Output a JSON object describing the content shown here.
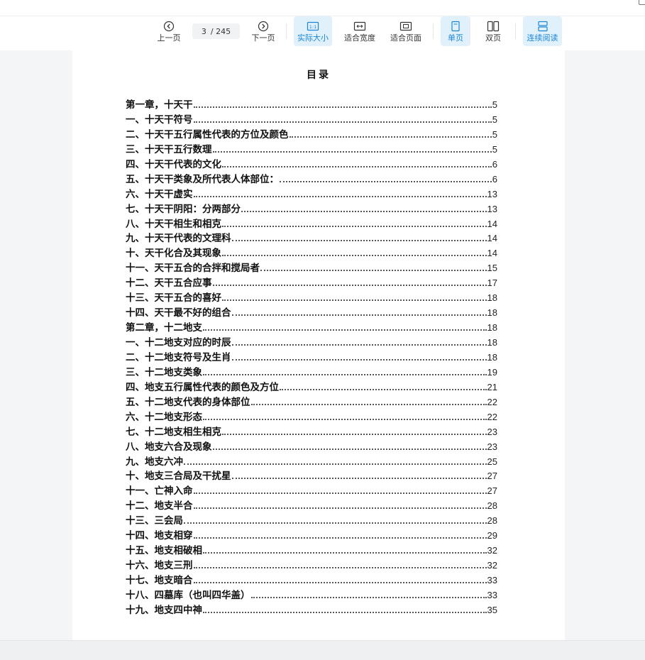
{
  "toolbar": {
    "page_current": "3",
    "page_total": "/ 245",
    "prev_label": "上一页",
    "next_label": "下一页",
    "actual_size_label": "实际大小",
    "fit_width_label": "适合宽度",
    "fit_page_label": "适合页面",
    "single_page_label": "单页",
    "double_page_label": "双页",
    "continuous_label": "连续阅读",
    "active_color": "#1b86d6",
    "active_bg": "#e1f1fb"
  },
  "document": {
    "title": "目录",
    "toc": [
      {
        "title": "第一章，十天干",
        "page": "5"
      },
      {
        "title": "一、十天干符号",
        "page": "5"
      },
      {
        "title": "二、十天干五行属性代表的方位及颜色",
        "page": "5"
      },
      {
        "title": "三、十天干五行数理",
        "page": "5"
      },
      {
        "title": "四、十天干代表的文化",
        "page": "6"
      },
      {
        "title": "五、十天干类象及所代表人体部位：",
        "page": "6"
      },
      {
        "title": "六、十天干虚实",
        "page": "13"
      },
      {
        "title": "七、十天干阴阳：分两部分",
        "page": "13"
      },
      {
        "title": "八、十天干相生和相克",
        "page": "14"
      },
      {
        "title": "九、十天干代表的文理科",
        "page": "14"
      },
      {
        "title": "十、天干化合及其现象",
        "page": "14"
      },
      {
        "title": "十一、天干五合的合拌和搅局者",
        "page": "15"
      },
      {
        "title": "十二、天干五合应事",
        "page": "17"
      },
      {
        "title": "十三、天干五合的喜好",
        "page": "18"
      },
      {
        "title": "十四、天干最不好的组合",
        "page": "18"
      },
      {
        "title": "第二章，十二地支",
        "page": "18"
      },
      {
        "title": "一、十二地支对应的时辰",
        "page": "18"
      },
      {
        "title": "二、十二地支符号及生肖",
        "page": "18"
      },
      {
        "title": "三、十二地支类象",
        "page": "19"
      },
      {
        "title": "四、地支五行属性代表的颜色及方位",
        "page": "21"
      },
      {
        "title": "五、十二地支代表的身体部位",
        "page": "22"
      },
      {
        "title": "六、十二地支形态",
        "page": "22"
      },
      {
        "title": "七、十二地支相生相克",
        "page": "23"
      },
      {
        "title": "八、地支六合及现象",
        "page": "23"
      },
      {
        "title": "九、地支六冲",
        "page": "25"
      },
      {
        "title": "十、地支三合局及干扰星",
        "page": "27"
      },
      {
        "title": "十一、亡神入命",
        "page": "27"
      },
      {
        "title": "十二、地支半合",
        "page": "28"
      },
      {
        "title": "十三、三会局",
        "page": "28"
      },
      {
        "title": "十四、地支相穿",
        "page": "29"
      },
      {
        "title": "十五、地支相破相",
        "page": "32"
      },
      {
        "title": "十六、地支三刑",
        "page": "32"
      },
      {
        "title": "十七、地支暗合",
        "page": "33"
      },
      {
        "title": "十八、四墓库（也叫四华盖）",
        "page": "33"
      },
      {
        "title": "十九、地支四中神",
        "page": "35"
      }
    ]
  }
}
